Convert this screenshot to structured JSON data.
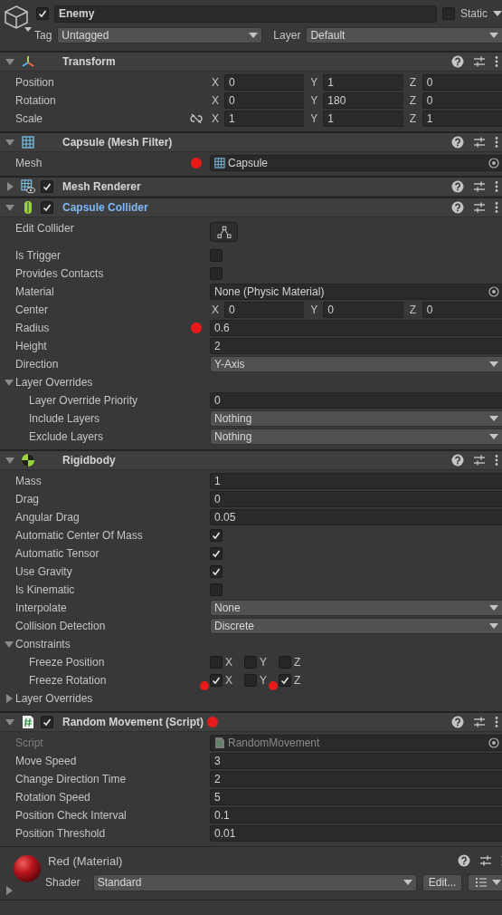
{
  "object_header": {
    "active": true,
    "name": "Enemy",
    "static": false,
    "static_label": "Static",
    "tag_label": "Tag",
    "tag": "Untagged",
    "layer_label": "Layer",
    "layer": "Default"
  },
  "components": [
    {
      "kind": "transform",
      "title": "Transform",
      "expanded": true,
      "overridden": false,
      "rows": [
        {
          "kind": "vector3",
          "label": "Position",
          "fields": [
            {
              "axis": "X",
              "value": "0"
            },
            {
              "axis": "Y",
              "value": "1"
            },
            {
              "axis": "Z",
              "value": "0"
            }
          ]
        },
        {
          "kind": "vector3",
          "label": "Rotation",
          "fields": [
            {
              "axis": "X",
              "value": "0"
            },
            {
              "axis": "Y",
              "value": "180"
            },
            {
              "axis": "Z",
              "value": "0"
            }
          ]
        },
        {
          "kind": "vector3",
          "label": "Scale",
          "proportional": false,
          "fields": [
            {
              "axis": "X",
              "value": "1"
            },
            {
              "axis": "Y",
              "value": "1"
            },
            {
              "axis": "Z",
              "value": "1"
            }
          ]
        }
      ]
    },
    {
      "kind": "mesh_filter",
      "title": "Capsule (Mesh Filter)",
      "expanded": true,
      "overridden": false,
      "rows": [
        {
          "kind": "object",
          "label": "Mesh",
          "value": "Capsule",
          "annotated": true
        }
      ]
    },
    {
      "kind": "mesh_renderer",
      "title": "Mesh Renderer",
      "expanded": false,
      "enabled": true,
      "overridden": false
    },
    {
      "kind": "capsule_collider",
      "title": "Capsule Collider",
      "expanded": true,
      "enabled": true,
      "overridden": true,
      "rows": [
        {
          "kind": "edit_button",
          "label": "Edit Collider"
        },
        {
          "kind": "checkbox",
          "label": "Is Trigger",
          "checked": false
        },
        {
          "kind": "checkbox",
          "label": "Provides Contacts",
          "checked": false
        },
        {
          "kind": "object",
          "label": "Material",
          "value": "None (Physic Material)"
        },
        {
          "kind": "vector3",
          "label": "Center",
          "fields": [
            {
              "axis": "X",
              "value": "0"
            },
            {
              "axis": "Y",
              "value": "0"
            },
            {
              "axis": "Z",
              "value": "0"
            }
          ]
        },
        {
          "kind": "number",
          "label": "Radius",
          "value": "0.6",
          "annotated": true
        },
        {
          "kind": "number",
          "label": "Height",
          "value": "2"
        },
        {
          "kind": "dropdown",
          "label": "Direction",
          "value": "Y-Axis"
        },
        {
          "kind": "foldout",
          "label": "Layer Overrides",
          "expanded": true,
          "children": [
            {
              "kind": "number",
              "label": "Layer Override Priority",
              "value": "0"
            },
            {
              "kind": "dropdown",
              "label": "Include Layers",
              "value": "Nothing"
            },
            {
              "kind": "dropdown",
              "label": "Exclude Layers",
              "value": "Nothing"
            }
          ]
        }
      ]
    },
    {
      "kind": "rigidbody",
      "title": "Rigidbody",
      "expanded": true,
      "overridden": false,
      "rows": [
        {
          "kind": "number",
          "label": "Mass",
          "value": "1"
        },
        {
          "kind": "number",
          "label": "Drag",
          "value": "0"
        },
        {
          "kind": "number",
          "label": "Angular Drag",
          "value": "0.05"
        },
        {
          "kind": "checkbox",
          "label": "Automatic Center Of Mass",
          "checked": true
        },
        {
          "kind": "checkbox",
          "label": "Automatic Tensor",
          "checked": true
        },
        {
          "kind": "checkbox",
          "label": "Use Gravity",
          "checked": true
        },
        {
          "kind": "checkbox",
          "label": "Is Kinematic",
          "checked": false
        },
        {
          "kind": "dropdown",
          "label": "Interpolate",
          "value": "None"
        },
        {
          "kind": "dropdown",
          "label": "Collision Detection",
          "value": "Discrete"
        },
        {
          "kind": "foldout",
          "label": "Constraints",
          "expanded": true,
          "children": [
            {
              "kind": "axis_checks",
              "label": "Freeze Position",
              "checks": [
                {
                  "axis": "X",
                  "checked": false
                },
                {
                  "axis": "Y",
                  "checked": false
                },
                {
                  "axis": "Z",
                  "checked": false
                }
              ]
            },
            {
              "kind": "axis_checks",
              "label": "Freeze Rotation",
              "checks": [
                {
                  "axis": "X",
                  "checked": true,
                  "annotated": true
                },
                {
                  "axis": "Y",
                  "checked": false
                },
                {
                  "axis": "Z",
                  "checked": true,
                  "annotated": true
                }
              ]
            }
          ]
        },
        {
          "kind": "foldout",
          "label": "Layer Overrides",
          "expanded": false
        }
      ]
    },
    {
      "kind": "script",
      "title": "Random Movement (Script)",
      "expanded": true,
      "enabled": true,
      "overridden": false,
      "annotated": true,
      "rows": [
        {
          "kind": "object",
          "label": "Script",
          "value": "RandomMovement",
          "disabled": true
        },
        {
          "kind": "number",
          "label": "Move Speed",
          "value": "3"
        },
        {
          "kind": "number",
          "label": "Change Direction Time",
          "value": "2"
        },
        {
          "kind": "number",
          "label": "Rotation Speed",
          "value": "5"
        },
        {
          "kind": "number",
          "label": "Position Check Interval",
          "value": "0.1"
        },
        {
          "kind": "number",
          "label": "Position Threshold",
          "value": "0.01"
        }
      ]
    }
  ],
  "material": {
    "name": "Red (Material)",
    "expanded": false,
    "shader_label": "Shader",
    "shader": "Standard",
    "edit_label": "Edit..."
  }
}
